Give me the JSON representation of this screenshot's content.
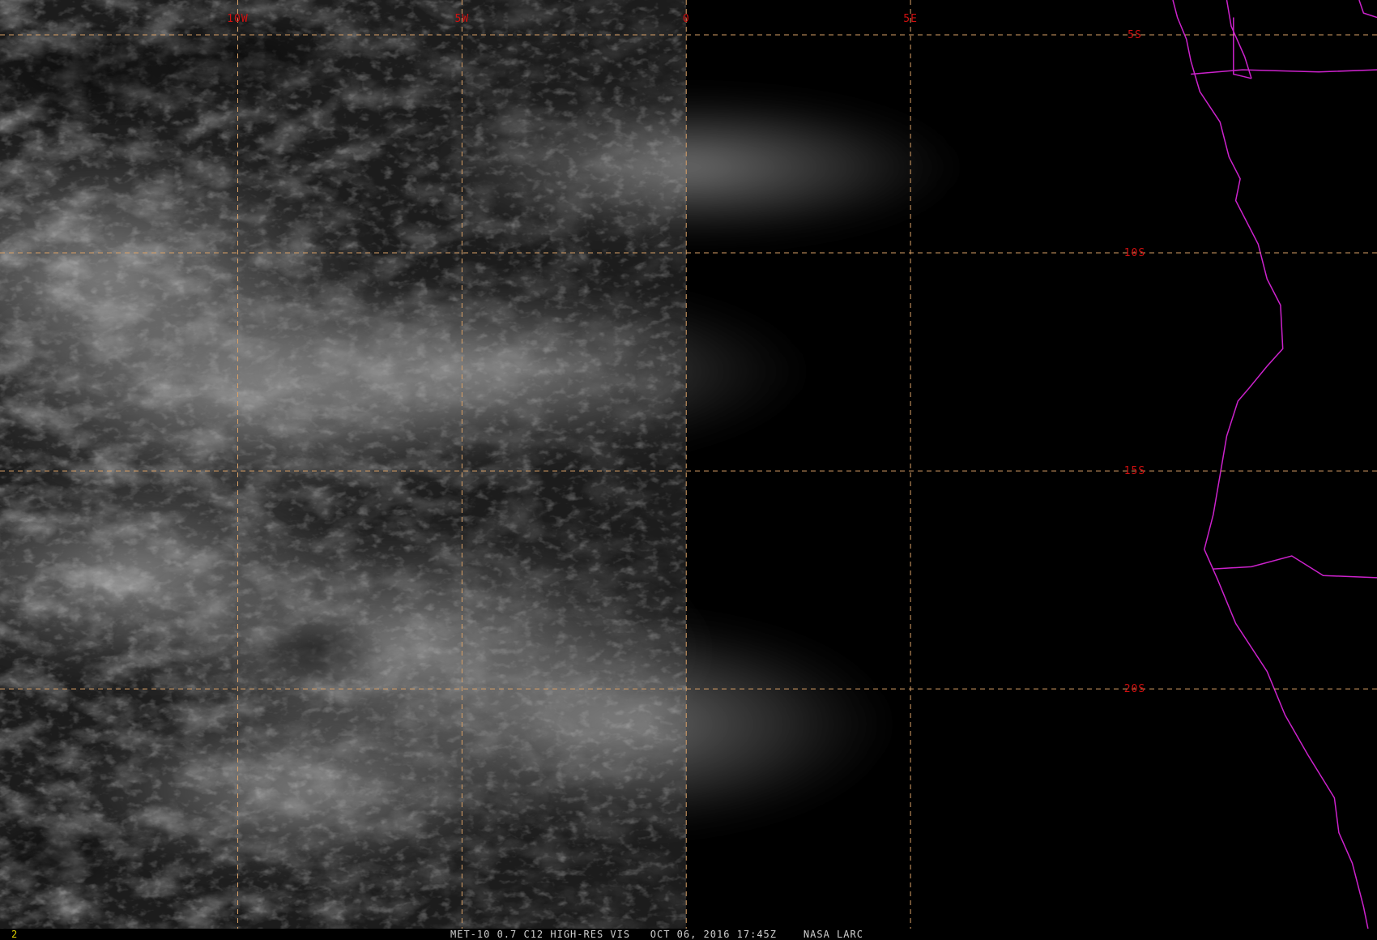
{
  "colors": {
    "grid": "#d9a066",
    "grid_label": "#d01010",
    "coastline": "#cc22cc",
    "caption": "#cfcfcf",
    "frame_number": "#e0d000",
    "background": "#000000"
  },
  "map": {
    "projection": "lat-lon",
    "lon_range": [
      -15.3,
      15.4
    ],
    "lat_range": [
      -4.2,
      -25.5
    ],
    "meridians": [
      {
        "lon": -10,
        "label": "10W"
      },
      {
        "lon": -5,
        "label": "5W"
      },
      {
        "lon": 0,
        "label": "0"
      },
      {
        "lon": 5,
        "label": "5E"
      }
    ],
    "parallels": [
      {
        "lat": -5,
        "label": "5S"
      },
      {
        "lat": -10,
        "label": "10S"
      },
      {
        "lat": -15,
        "label": "15S"
      },
      {
        "lat": -20,
        "label": "20S"
      }
    ],
    "day_night_terminator_lon": 0,
    "coastline_lonlat": [
      [
        10.85,
        -4.2
      ],
      [
        10.95,
        -4.6
      ],
      [
        11.15,
        -5.1
      ],
      [
        11.25,
        -5.6
      ],
      [
        11.45,
        -6.3
      ],
      [
        11.9,
        -7.0
      ],
      [
        12.1,
        -7.8
      ],
      [
        12.35,
        -8.3
      ],
      [
        12.25,
        -8.8
      ],
      [
        12.75,
        -9.8
      ],
      [
        12.95,
        -10.6
      ],
      [
        13.25,
        -11.2
      ],
      [
        13.3,
        -12.2
      ],
      [
        12.95,
        -12.6
      ],
      [
        12.55,
        -13.1
      ],
      [
        12.3,
        -13.4
      ],
      [
        12.05,
        -14.2
      ],
      [
        11.9,
        -15.1
      ],
      [
        11.75,
        -16.0
      ],
      [
        11.55,
        -16.8
      ],
      [
        11.85,
        -17.5
      ],
      [
        12.25,
        -18.5
      ],
      [
        12.95,
        -19.6
      ],
      [
        13.35,
        -20.6
      ],
      [
        13.85,
        -21.5
      ],
      [
        14.45,
        -22.5
      ],
      [
        14.55,
        -23.3
      ],
      [
        14.85,
        -24.0
      ],
      [
        15.1,
        -25.0
      ],
      [
        15.2,
        -25.5
      ]
    ],
    "borders_lonlat": [
      [
        [
          12.05,
          -4.2
        ],
        [
          12.15,
          -4.8
        ],
        [
          12.45,
          -5.5
        ],
        [
          12.6,
          -6.0
        ]
      ],
      [
        [
          12.2,
          -4.6
        ],
        [
          12.2,
          -5.9
        ],
        [
          12.6,
          -6.0
        ]
      ],
      [
        [
          11.25,
          -5.9
        ],
        [
          12.4,
          -5.8
        ],
        [
          14.1,
          -5.85
        ],
        [
          15.4,
          -5.8
        ]
      ],
      [
        [
          11.75,
          -17.25
        ],
        [
          12.6,
          -17.2
        ],
        [
          13.5,
          -16.95
        ],
        [
          14.2,
          -17.4
        ],
        [
          15.4,
          -17.45
        ]
      ],
      [
        [
          15.0,
          -4.2
        ],
        [
          15.1,
          -4.5
        ],
        [
          15.4,
          -4.6
        ]
      ]
    ]
  },
  "status_bar": {
    "frame_number": "2",
    "caption": "MET-10 0.7 C12 HIGH-RES VIS   OCT 06, 2016 17:45Z    NASA LARC"
  }
}
